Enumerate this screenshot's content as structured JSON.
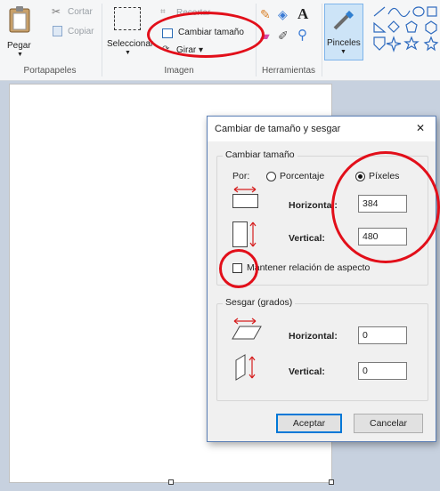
{
  "ribbon": {
    "clipboard": {
      "paste": "Pegar",
      "cut": "Cortar",
      "copy": "Copiar",
      "group": "Portapapeles"
    },
    "image": {
      "select": "Seleccionar",
      "crop": "Recortar",
      "resize": "Cambiar tamaño",
      "rotate": "Girar ▾",
      "group": "Imagen"
    },
    "tools": {
      "group": "Herramientas",
      "text_tool": "A"
    },
    "brushes": {
      "label": "Pinceles"
    }
  },
  "dialog": {
    "title": "Cambiar de tamaño y sesgar",
    "close": "✕",
    "resize_section": "Cambiar tamaño",
    "by_label": "Por:",
    "percent_option": "Porcentaje",
    "pixels_option": "Píxeles",
    "selected_unit": "Píxeles",
    "horizontal_label": "Horizontal:",
    "vertical_label": "Vertical:",
    "resize_horizontal": "384",
    "resize_vertical": "480",
    "keep_aspect": "Mantener relación de aspecto",
    "keep_aspect_checked": false,
    "skew_section": "Sesgar (grados)",
    "skew_horizontal": "0",
    "skew_vertical": "0",
    "ok": "Aceptar",
    "cancel": "Cancelar"
  },
  "colors": {
    "annotation_red": "#e20f1a",
    "accent": "#0078d7"
  }
}
